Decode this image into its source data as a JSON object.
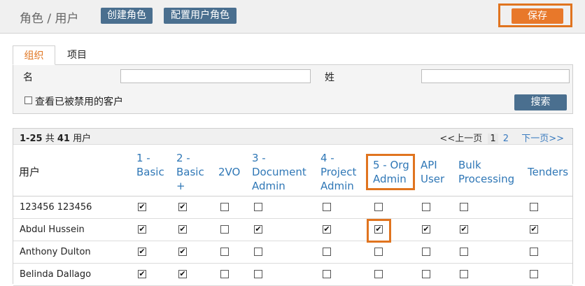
{
  "header": {
    "title": "角色 / 用户",
    "create_role": "创建角色",
    "config_roles": "配置用户角色",
    "save": "保存"
  },
  "tabs": [
    "组织",
    "项目"
  ],
  "search": {
    "first_name_label": "名",
    "last_name_label": "姓",
    "first_name_value": "",
    "last_name_value": "",
    "show_disabled_label": "查看已被禁用的客户",
    "search_button": "搜索"
  },
  "table": {
    "range": "1-25",
    "of_word": "共",
    "total": "41",
    "unit": "用户",
    "pager": {
      "prev": "<<上一页",
      "current": "1",
      "next_page": "2",
      "next": "下一页>>"
    },
    "user_col": "用户",
    "columns": [
      {
        "l1": "1 -",
        "l2": "Basic",
        "l3": ""
      },
      {
        "l1": "2 -",
        "l2": "Basic",
        "l3": "+"
      },
      {
        "l1": "",
        "l2": "2VO",
        "l3": ""
      },
      {
        "l1": "3 -",
        "l2": "Document",
        "l3": "Admin"
      },
      {
        "l1": "4 -",
        "l2": "Project",
        "l3": "Admin"
      },
      {
        "l1": "",
        "l2": "5 - Org",
        "l3": "Admin"
      },
      {
        "l1": "",
        "l2": "API",
        "l3": "User"
      },
      {
        "l1": "",
        "l2": "Bulk",
        "l3": "Processing"
      },
      {
        "l1": "",
        "l2": "Tenders",
        "l3": ""
      }
    ],
    "rows": [
      {
        "name": "123456 123456",
        "checks": [
          true,
          true,
          false,
          false,
          false,
          false,
          false,
          false,
          false
        ]
      },
      {
        "name": "Abdul Hussein",
        "checks": [
          true,
          true,
          false,
          true,
          true,
          true,
          true,
          true,
          true
        ]
      },
      {
        "name": "Anthony Dulton",
        "checks": [
          true,
          true,
          false,
          false,
          false,
          false,
          false,
          false,
          false
        ]
      },
      {
        "name": "Belinda Dallago",
        "checks": [
          true,
          true,
          false,
          false,
          false,
          false,
          false,
          false,
          false
        ]
      }
    ]
  },
  "colors": {
    "accent": "#e0741f",
    "button": "#4a6f8f",
    "link": "#2f77b6"
  }
}
